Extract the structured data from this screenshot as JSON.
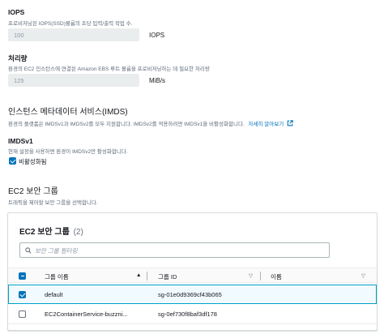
{
  "iops": {
    "label": "IOPS",
    "description": "프로비저닝된 IOPS(SSD)볼륨의 초당 입력/출력 작업 수.",
    "value": "100",
    "unit": "IOPS"
  },
  "throughput": {
    "label": "처리량",
    "description": "환경의 EC2 인스턴스에 연결된 Amazon EBS 루트 볼륨을 프로비저닝하는 데 필요한 처리량",
    "value": "125",
    "unit": "MiB/s"
  },
  "imds": {
    "heading": "인스턴스 메타데이터 서비스(IMDS)",
    "description": "환경의 플랫폼은 IMDSv1과 IMDSv2를 모두 지원합니다. IMDSv2를 적용하려면 IMDSv1을 비활성화합니다.",
    "learn_more": "자세히 알아보기",
    "imdsv1_label": "IMDSv1",
    "imdsv1_description": "현재 설정을 사용하면 환경이 IMDSv2만 활성화합니다.",
    "disabled_label": "비활성화됨",
    "disabled_checked": true
  },
  "security_groups": {
    "heading": "EC2 보안 그룹",
    "description": "트래픽을 제어할 보안 그룹을 선택합니다.",
    "panel_title": "EC2 보안 그룹",
    "count": "(2)",
    "filter_placeholder": "보안 그룹 필터링",
    "columns": {
      "name": "그룹 이름",
      "id": "그룹 ID",
      "tag_name": "이름"
    },
    "rows": [
      {
        "name": "default",
        "id": "sg-01e0d9369cf43b065",
        "selected": true
      },
      {
        "name": "EC2ContainerService-buzzni...",
        "id": "sg-0ef730f8baf3df178",
        "selected": false
      }
    ]
  },
  "colors": {
    "accent": "#0073bb",
    "selected_row_bg": "#f1faff",
    "selected_row_border": "#00a1c9"
  }
}
